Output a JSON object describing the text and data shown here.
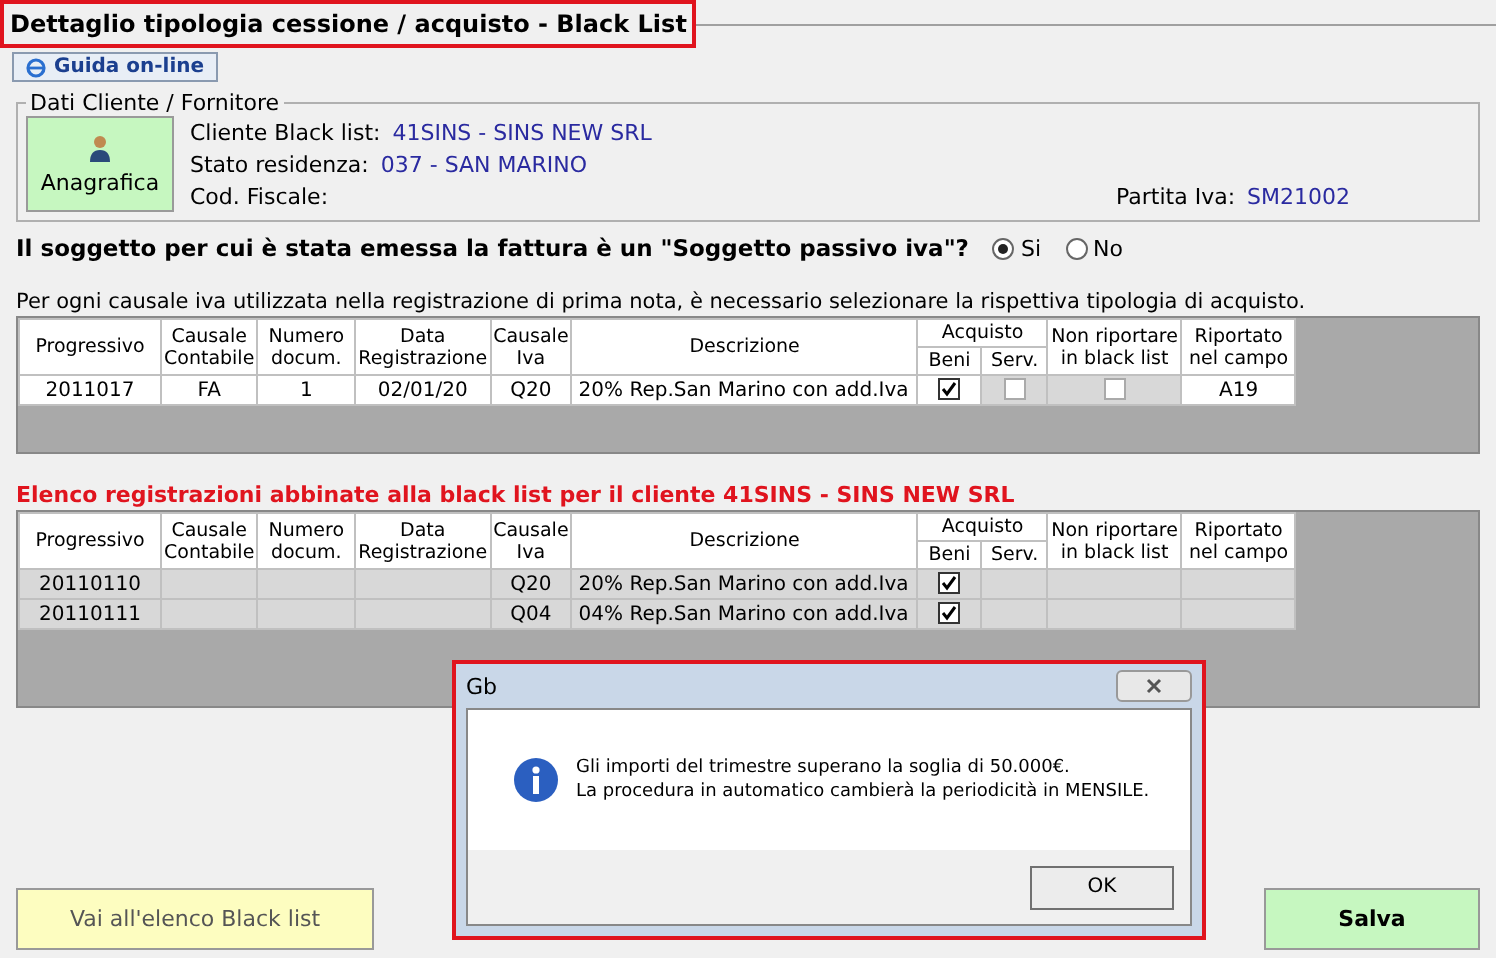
{
  "window": {
    "title": "Dettaglio tipologia cessione / acquisto - Black List"
  },
  "help_button": {
    "label": "Guida on-line"
  },
  "client_group": {
    "title": "Dati Cliente / Fornitore",
    "button": {
      "label": "Anagrafica"
    },
    "fields": [
      {
        "label": "Cliente Black list:",
        "value": "41SINS - SINS NEW SRL"
      },
      {
        "label": "Stato residenza:",
        "value": "037 - SAN MARINO"
      },
      {
        "label": "Cod. Fiscale:"
      }
    ],
    "vat": {
      "label": "Partita Iva:",
      "value": "SM21002"
    }
  },
  "question": {
    "text": "Il soggetto per cui è stata emessa la fattura è un \"Soggetto passivo iva\"?",
    "options": [
      {
        "label": "Si",
        "selected": true
      },
      {
        "label": "No",
        "selected": false
      }
    ]
  },
  "instruction": "Per ogni causale iva utilizzata nella registrazione di prima nota, è necessario selezionare la rispettiva tipologia di acquisto.",
  "table": {
    "columns": [
      {
        "label": "Progressivo"
      },
      {
        "label": "Causale Contabile"
      },
      {
        "label": "Numero docum."
      },
      {
        "label": "Data Registrazione"
      },
      {
        "label": "Causale Iva"
      },
      {
        "label": "Descrizione"
      },
      {
        "label": "Acquisto",
        "children": [
          {
            "label": "Beni"
          },
          {
            "label": "Serv."
          }
        ]
      },
      {
        "label": "Non riportare in black list"
      },
      {
        "label": "Riportato nel campo"
      }
    ],
    "rows": [
      {
        "cells": [
          {
            "kind": "text",
            "text": "2011017"
          },
          {
            "kind": "text",
            "text": "FA"
          },
          {
            "kind": "text",
            "text": "1"
          },
          {
            "kind": "text",
            "text": "02/01/20"
          },
          {
            "kind": "text",
            "text": "Q20"
          },
          {
            "kind": "text",
            "text": "20% Rep.San Marino con add.Iva"
          },
          {
            "kind": "checkbox",
            "checked": true,
            "disabled": false
          },
          {
            "kind": "checkbox",
            "checked": false,
            "disabled": true
          },
          {
            "kind": "checkbox",
            "checked": false,
            "disabled": true
          },
          {
            "kind": "text",
            "text": "A19"
          }
        ]
      }
    ]
  },
  "linked_title": "Elenco registrazioni abbinate alla black list per il cliente 41SINS - SINS NEW SRL",
  "linked_table": {
    "columns": [
      {
        "label": "Progressivo"
      },
      {
        "label": "Causale Contabile"
      },
      {
        "label": "Numero docum."
      },
      {
        "label": "Data Registrazione"
      },
      {
        "label": "Causale Iva"
      },
      {
        "label": "Descrizione"
      },
      {
        "label": "Acquisto",
        "children": [
          {
            "label": "Beni"
          },
          {
            "label": "Serv."
          }
        ]
      },
      {
        "label": "Non riportare in black list"
      },
      {
        "label": "Riportato nel campo"
      }
    ],
    "rows": [
      {
        "cells": [
          {
            "kind": "text",
            "text": "20110110"
          },
          {
            "kind": "empty"
          },
          {
            "kind": "empty"
          },
          {
            "kind": "empty"
          },
          {
            "kind": "text",
            "text": "Q20"
          },
          {
            "kind": "text",
            "text": "20% Rep.San Marino con add.Iva"
          },
          {
            "kind": "checkbox",
            "checked": true,
            "disabled": false
          },
          {
            "kind": "empty"
          },
          {
            "kind": "empty"
          },
          {
            "kind": "empty"
          }
        ]
      },
      {
        "cells": [
          {
            "kind": "text",
            "text": "20110111"
          },
          {
            "kind": "empty"
          },
          {
            "kind": "empty"
          },
          {
            "kind": "empty"
          },
          {
            "kind": "text",
            "text": "Q04"
          },
          {
            "kind": "text",
            "text": "04% Rep.San Marino con add.Iva"
          },
          {
            "kind": "checkbox",
            "checked": true,
            "disabled": false
          },
          {
            "kind": "empty"
          },
          {
            "kind": "empty"
          },
          {
            "kind": "empty"
          }
        ]
      }
    ]
  },
  "footer_buttons": [
    {
      "label": "Vai all'elenco Black list",
      "kind": "secondary"
    },
    {
      "label": "Salva",
      "kind": "primary"
    }
  ],
  "dialog": {
    "title": "Gb",
    "lines": [
      "Gli importi del trimestre superano la soglia di 50.000€.",
      "La procedura in automatico cambierà la periodicità in MENSILE."
    ],
    "button": "OK"
  }
}
